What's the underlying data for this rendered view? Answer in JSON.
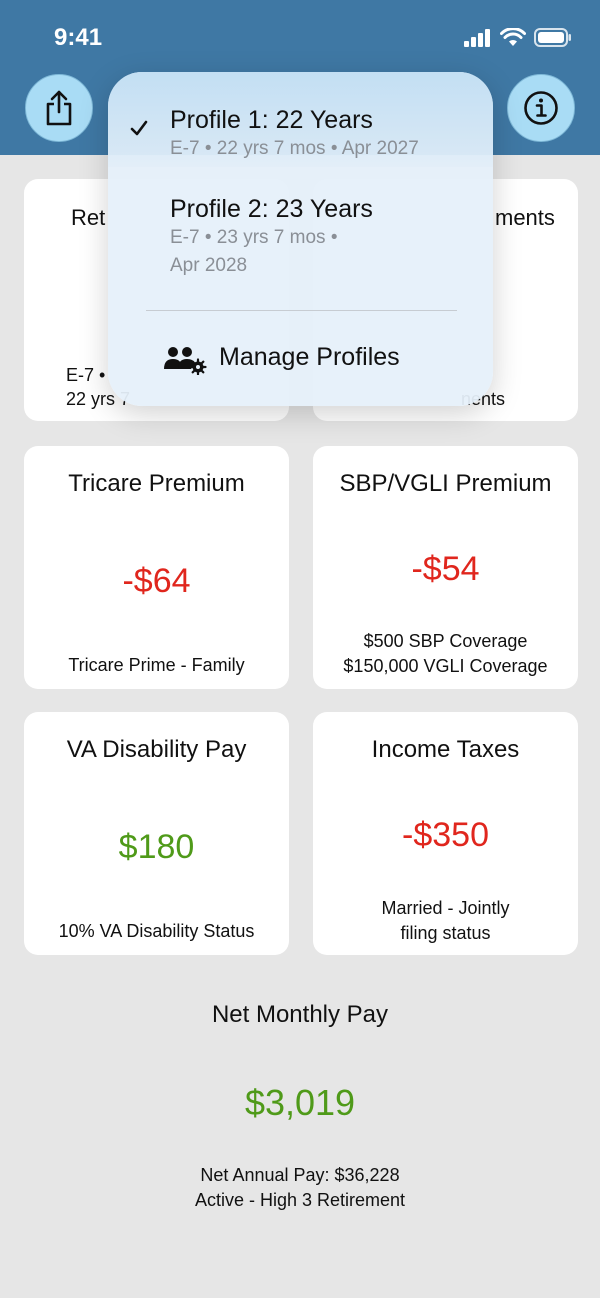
{
  "status_bar": {
    "time": "9:41"
  },
  "header": {
    "share_icon": "share-icon",
    "info_icon": "info-icon"
  },
  "behind_cards": {
    "left_title_partial": "Ret",
    "left_sub_line1": "E-7 •",
    "left_sub_line2": "22 yrs 7",
    "right_title_partial": "ments",
    "right_sub_partial": "nents"
  },
  "profile_menu": {
    "items": [
      {
        "label": "Profile 1: 22 Years",
        "detail": "E-7 • 22 yrs 7 mos • Apr 2027",
        "selected": true
      },
      {
        "label": "Profile 2: 23 Years",
        "detail_line1": "E-7 • 23 yrs 7 mos •",
        "detail_line2": "Apr 2028",
        "selected": false
      }
    ],
    "manage_label": "Manage Profiles"
  },
  "cards": {
    "tricare": {
      "title": "Tricare Premium",
      "value": "-$64",
      "sub": "Tricare Prime - Family"
    },
    "sbp": {
      "title": "SBP/VGLI Premium",
      "value": "-$54",
      "sub_line1": "$500 SBP Coverage",
      "sub_line2": "$150,000 VGLI Coverage"
    },
    "va": {
      "title": "VA Disability Pay",
      "value": "$180",
      "sub": "10% VA Disability Status"
    },
    "taxes": {
      "title": "Income Taxes",
      "value": "-$350",
      "sub_line1": "Married - Jointly",
      "sub_line2": "filing status"
    }
  },
  "net": {
    "title": "Net Monthly Pay",
    "value": "$3,019",
    "sub_line1": "Net Annual Pay: $36,228",
    "sub_line2": "Active - High 3 Retirement"
  },
  "colors": {
    "header": "#3f78a4",
    "positive": "#4f9a19",
    "negative": "#e0261d",
    "button": "#a9dcf5"
  }
}
